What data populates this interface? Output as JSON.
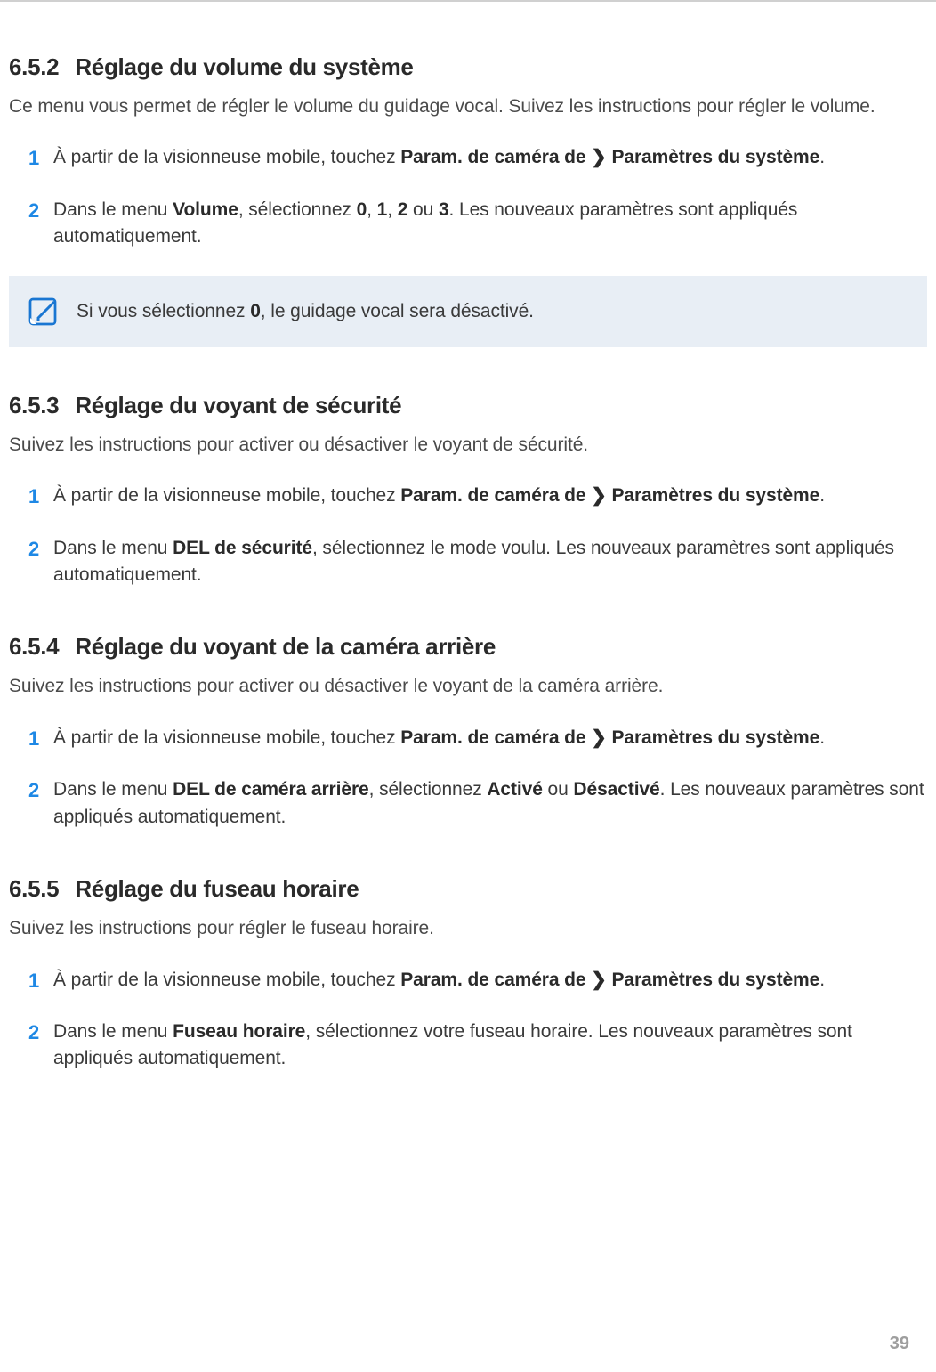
{
  "sections": [
    {
      "num": "6.5.2",
      "title": "Réglage du volume du système",
      "intro": "Ce menu vous permet de régler le volume du guidage vocal. Suivez les instructions pour régler le volume.",
      "step1": {
        "prefix": "À partir de la visionneuse mobile, touchez ",
        "bold1": "Param. de caméra de",
        "bold2": "Paramètres du système",
        "suffix": "."
      },
      "step2": {
        "t1": "Dans le menu ",
        "b1": "Volume",
        "t2": ", sélectionnez ",
        "b2": "0",
        "t3": ", ",
        "b3": "1",
        "t4": ", ",
        "b4": "2",
        "t5": " ou ",
        "b5": "3",
        "t6": ". Les nouveaux paramètres sont appliqués automatiquement."
      },
      "note": {
        "t1": "Si vous sélectionnez ",
        "b1": "0",
        "t2": ", le guidage vocal sera désactivé."
      }
    },
    {
      "num": "6.5.3",
      "title": "Réglage du voyant de sécurité",
      "intro": "Suivez les instructions pour activer ou désactiver le voyant de sécurité.",
      "step1": {
        "prefix": "À partir de la visionneuse mobile, touchez ",
        "bold1": "Param. de caméra de",
        "bold2": "Paramètres du système",
        "suffix": "."
      },
      "step2": {
        "t1": "Dans le menu ",
        "b1": "DEL de sécurité",
        "t2": ", sélectionnez le mode voulu. Les nouveaux paramètres sont appliqués automatiquement."
      }
    },
    {
      "num": "6.5.4",
      "title": "Réglage du voyant de la caméra arrière",
      "intro": "Suivez les instructions pour activer ou désactiver le voyant de la caméra arrière.",
      "step1": {
        "prefix": "À partir de la visionneuse mobile, touchez ",
        "bold1": "Param. de caméra de",
        "bold2": "Paramètres du système",
        "suffix": "."
      },
      "step2": {
        "t1": "Dans le menu ",
        "b1": "DEL de caméra arrière",
        "t2": ", sélectionnez ",
        "b2": "Activé",
        "t3": " ou ",
        "b3": "Désactivé",
        "t4": ". Les nouveaux paramètres sont appliqués automatiquement."
      }
    },
    {
      "num": "6.5.5",
      "title": "Réglage du fuseau horaire",
      "intro": "Suivez les instructions pour régler le fuseau horaire.",
      "step1": {
        "prefix": "À partir de la visionneuse mobile, touchez ",
        "bold1": "Param. de caméra de",
        "bold2": "Paramètres du système",
        "suffix": "."
      },
      "step2": {
        "t1": "Dans le menu ",
        "b1": "Fuseau horaire",
        "t2": ", sélectionnez votre fuseau horaire. Les nouveaux paramètres sont appliqués automatiquement."
      }
    }
  ],
  "page_number": "39"
}
